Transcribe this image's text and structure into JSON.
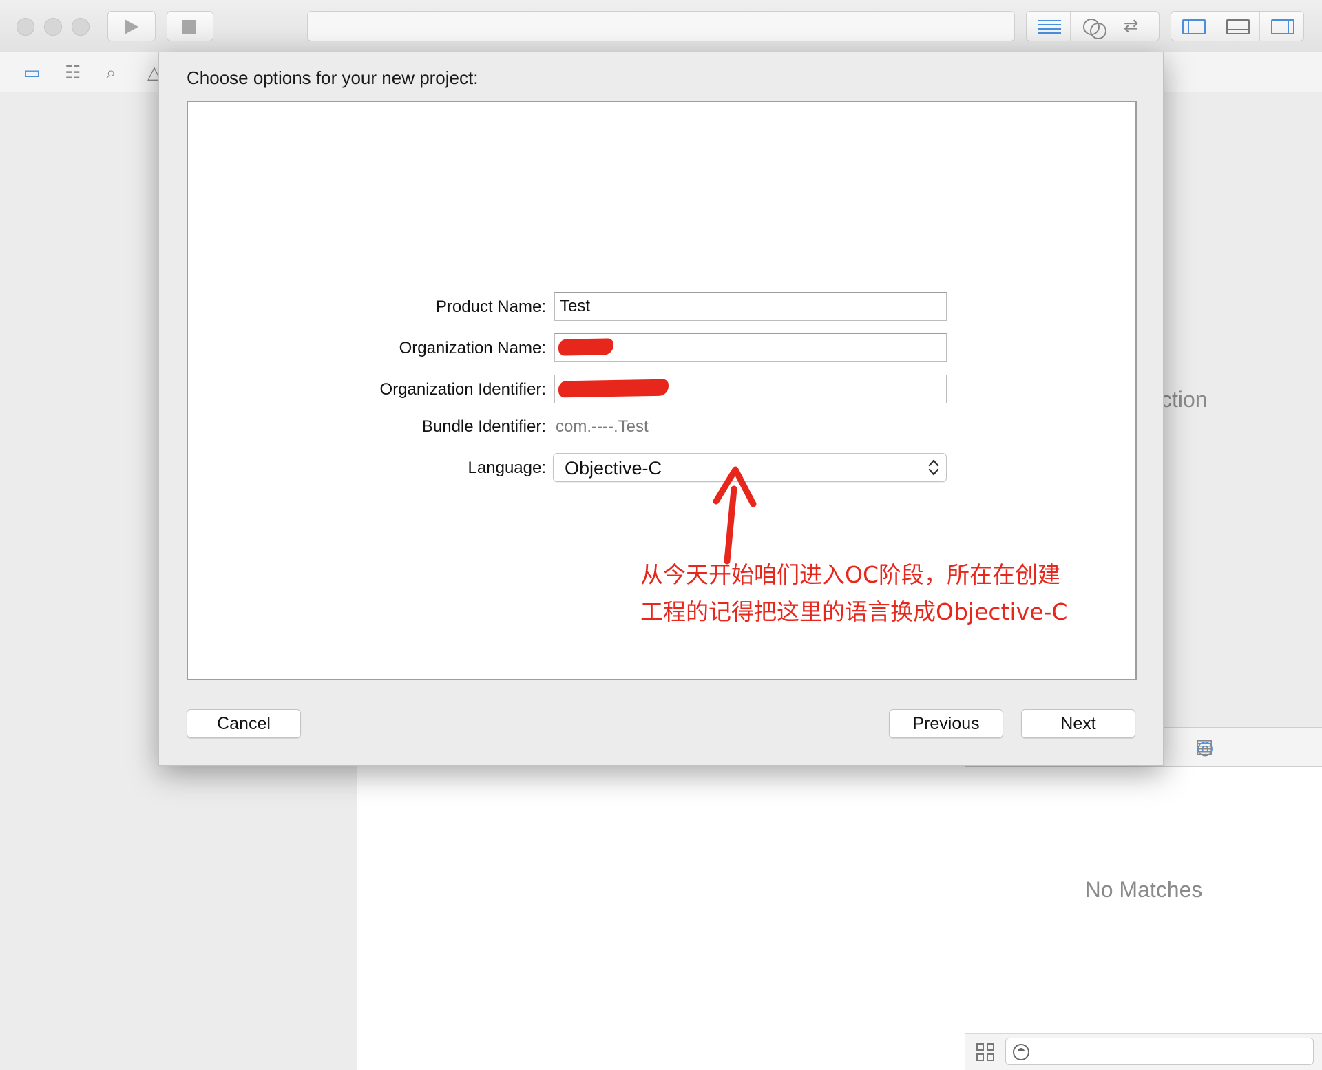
{
  "dialog": {
    "title": "Choose options for your new project:",
    "fields": {
      "product_name": {
        "label": "Product Name:",
        "value": "Test"
      },
      "organization_name": {
        "label": "Organization Name:",
        "value": ""
      },
      "organization_identifier": {
        "label": "Organization Identifier:",
        "value": ""
      },
      "bundle_identifier": {
        "label": "Bundle Identifier:",
        "value": "com.----.Test"
      },
      "language": {
        "label": "Language:",
        "value": "Objective-C"
      }
    },
    "buttons": {
      "cancel": "Cancel",
      "previous": "Previous",
      "next": "Next"
    }
  },
  "annotation": {
    "line1": "从今天开始咱们进入OC阶段，所在在创建",
    "line2": "工程的记得把这里的语言换成Objective-C",
    "color": "#e8271c"
  },
  "inspector": {
    "partial_text": "ction"
  },
  "library": {
    "empty_text": "No Matches"
  },
  "icons": {
    "toolbar": [
      "close-dot",
      "minimize-dot",
      "zoom-dot",
      "run-icon",
      "stop-icon",
      "standard-editor-icon",
      "assistant-editor-icon",
      "version-editor-icon",
      "navigator-toggle-icon",
      "debug-area-toggle-icon",
      "utilities-toggle-icon"
    ],
    "navigator": [
      "folder-icon",
      "hierarchy-icon",
      "search-icon",
      "warning-icon"
    ]
  },
  "colors": {
    "accent": "#4a8fdc",
    "annotation": "#e8271c"
  }
}
